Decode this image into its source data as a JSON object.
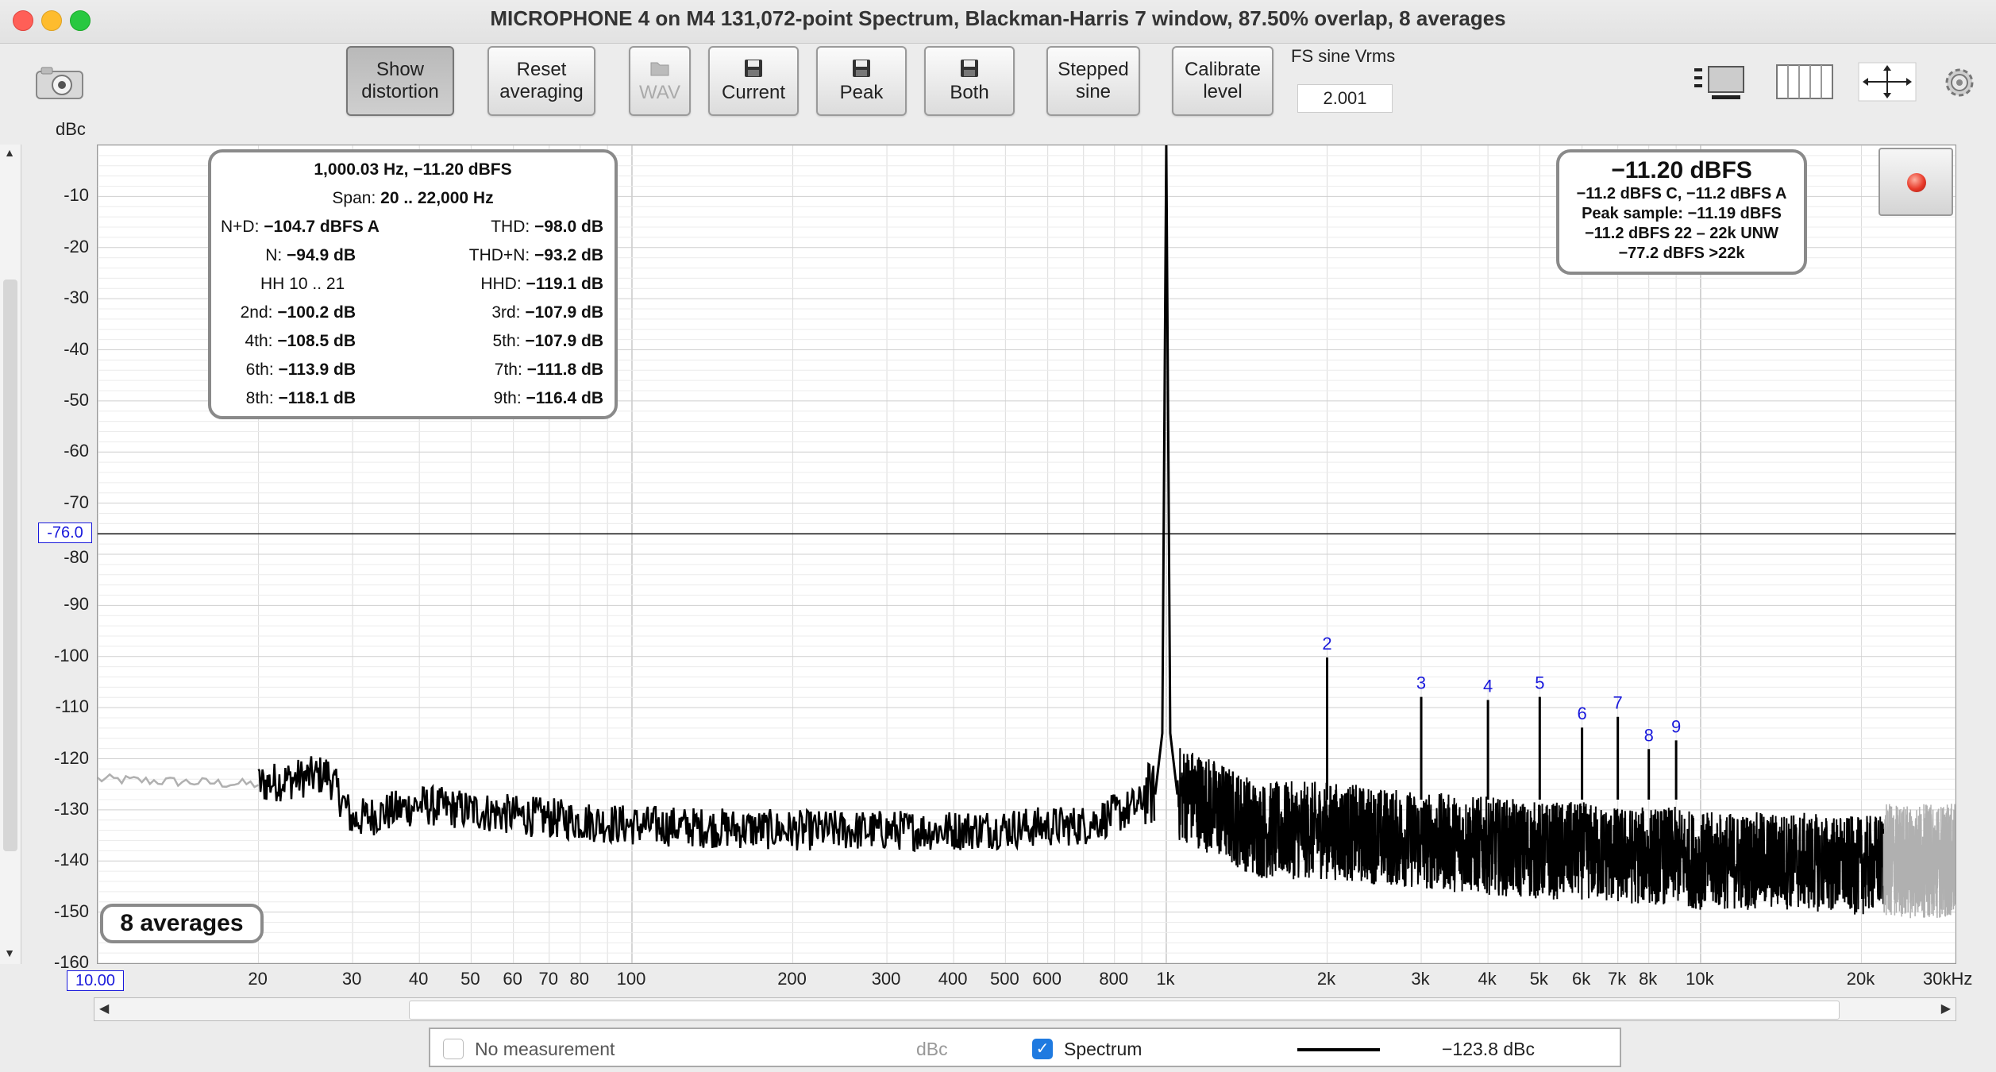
{
  "window": {
    "title": "MICROPHONE 4 on M4 131,072-point Spectrum, Blackman-Harris 7 window, 87.50% overlap, 8 averages"
  },
  "toolbar": {
    "show_distortion_line1": "Show",
    "show_distortion_line2": "distortion",
    "reset_line1": "Reset",
    "reset_line2": "averaging",
    "wav": "WAV",
    "current": "Current",
    "peak": "Peak",
    "both": "Both",
    "stepped_line1": "Stepped",
    "stepped_line2": "sine",
    "calibrate_line1": "Calibrate",
    "calibrate_line2": "level",
    "fs_label": "FS sine Vrms",
    "fs_value": "2.001"
  },
  "plot": {
    "y_unit": "dBc",
    "x_unit_label": "30kHz",
    "x_min_label": "10.00",
    "cursor_value": "-76.0",
    "yticks": [
      "-10",
      "-20",
      "-30",
      "-40",
      "-50",
      "-60",
      "-70",
      "-80",
      "-90",
      "-100",
      "-110",
      "-120",
      "-130",
      "-140",
      "-150",
      "-160"
    ],
    "xticks": [
      "20",
      "30",
      "40",
      "50",
      "60",
      "70",
      "80",
      "100",
      "200",
      "300",
      "400",
      "500",
      "600",
      "800",
      "1k",
      "2k",
      "3k",
      "4k",
      "5k",
      "6k",
      "7k",
      "8k",
      "10k",
      "20k"
    ],
    "harmonic_labels": [
      "2",
      "3",
      "4",
      "5",
      "6",
      "7",
      "8",
      "9"
    ],
    "averages_badge": "8 averages"
  },
  "distortion_box": {
    "header": "1,000.03 Hz, −11.20 dBFS",
    "span_label": "Span: ",
    "span_value": "20 .. 22,000 Hz",
    "nd_label": "N+D: ",
    "nd_value": "−104.7 dBFS A",
    "thd_label": "THD: ",
    "thd_value": "−98.0 dB",
    "n_label": "N: ",
    "n_value": "−94.9 dB",
    "thdn_label": "THD+N: ",
    "thdn_value": "−93.2 dB",
    "hh_label": "HH 10 .. 21",
    "hhd_label": "HHD: ",
    "hhd_value": "−119.1 dB",
    "h2_label": "2nd: ",
    "h2_value": "−100.2 dB",
    "h3_label": "3rd: ",
    "h3_value": "−107.9 dB",
    "h4_label": "4th: ",
    "h4_value": "−108.5 dB",
    "h5_label": "5th: ",
    "h5_value": "−107.9 dB",
    "h6_label": "6th: ",
    "h6_value": "−113.9 dB",
    "h7_label": "7th: ",
    "h7_value": "−111.8 dB",
    "h8_label": "8th: ",
    "h8_value": "−118.1 dB",
    "h9_label": "9th: ",
    "h9_value": "−116.4 dB"
  },
  "level_box": {
    "main": "−11.20 dBFS",
    "line1": "−11.2 dBFS C, −11.2 dBFS A",
    "line2": "Peak sample: −11.19 dBFS",
    "line3": "−11.2 dBFS 22 – 22k UNW",
    "line4": "−77.2 dBFS >22k"
  },
  "legend": {
    "no_measurement": "No measurement",
    "unit": "dBc",
    "spectrum": "Spectrum",
    "spectrum_value": "−123.8 dBc"
  },
  "colors": {
    "trace": "#000000",
    "trace_out_of_band": "#b0b0b0",
    "harmonic_label": "#1a1adc",
    "record": "#e83a2a",
    "checkbox": "#1f7ae0"
  },
  "chart_data": {
    "type": "line",
    "xscale": "log",
    "xlim": [
      10,
      30000
    ],
    "ylim": [
      -160,
      0
    ],
    "ylabel": "dBc",
    "series": [
      {
        "name": "Spectrum",
        "x": [
          10,
          20,
          27,
          30,
          40,
          60,
          100,
          200,
          400,
          700,
          900,
          1000,
          1100,
          1500,
          2000,
          3000,
          4000,
          5000,
          6000,
          7000,
          8000,
          9000,
          10000,
          15000,
          20000,
          22000,
          30000
        ],
        "y": [
          -124,
          -125,
          -123,
          -132,
          -129,
          -131,
          -133,
          -134,
          -134,
          -133,
          -129,
          0,
          -127,
          -134,
          -134,
          -136,
          -137,
          -138,
          -138,
          -139,
          -139,
          -139,
          -140,
          -140,
          -141,
          -140,
          -140
        ]
      }
    ],
    "harmonics": [
      {
        "n": 2,
        "freq": 2000,
        "level": -100.2
      },
      {
        "n": 3,
        "freq": 3000,
        "level": -107.9
      },
      {
        "n": 4,
        "freq": 4000,
        "level": -108.5
      },
      {
        "n": 5,
        "freq": 5000,
        "level": -107.9
      },
      {
        "n": 6,
        "freq": 6000,
        "level": -113.9
      },
      {
        "n": 7,
        "freq": 7000,
        "level": -111.8
      },
      {
        "n": 8,
        "freq": 8000,
        "level": -118.1
      },
      {
        "n": 9,
        "freq": 9000,
        "level": -116.4
      }
    ],
    "cursor_y": -76.0
  }
}
